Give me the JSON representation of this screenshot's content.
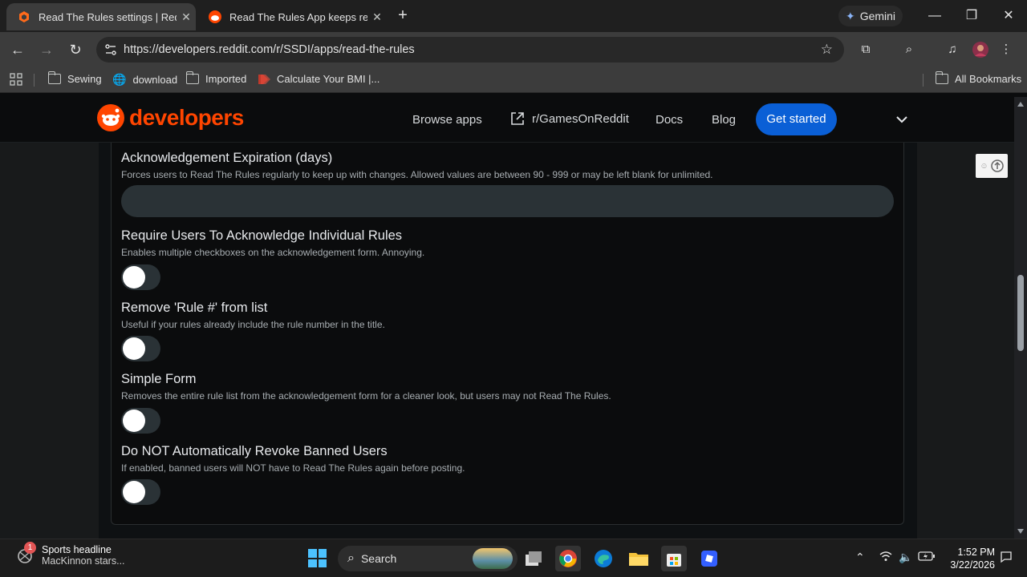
{
  "browser": {
    "tabs": [
      {
        "title": "Read The Rules settings | Reddit",
        "active": true
      },
      {
        "title": "Read The Rules App keeps remembering",
        "active": false
      }
    ],
    "gemini_label": "Gemini",
    "url": "https://developers.reddit.com/r/SSDI/apps/read-the-rules",
    "bookmarks": [
      "Sewing",
      "download",
      "Imported",
      "Calculate Your BMI |..."
    ],
    "all_bookmarks": "All Bookmarks"
  },
  "site": {
    "logo_text": "developers",
    "nav": [
      "Browse apps",
      "r/GamesOnReddit",
      "Docs",
      "Blog"
    ],
    "cta": "Get started"
  },
  "settings": {
    "expiration": {
      "label": "Acknowledgement Expiration (days)",
      "description": "Forces users to Read The Rules regularly to keep up with changes. Allowed values are between 90 - 999 or may be left blank for unlimited.",
      "value": ""
    },
    "toggles": [
      {
        "label": "Require Users To Acknowledge Individual Rules",
        "description": "Enables multiple checkboxes on the acknowledgement form. Annoying.",
        "enabled": false
      },
      {
        "label": "Remove 'Rule #' from list",
        "description": "Useful if your rules already include the rule number in the title.",
        "enabled": false
      },
      {
        "label": "Simple Form",
        "description": "Removes the entire rule list from the acknowledgement form for a cleaner look, but users may not Read The Rules.",
        "enabled": false
      },
      {
        "label": "Do NOT Automatically Revoke Banned Users",
        "description": "If enabled, banned users will NOT have to Read The Rules again before posting.",
        "enabled": false
      }
    ]
  },
  "taskbar": {
    "widget_badge": "1",
    "widget_title": "Sports headline",
    "widget_sub": "MacKinnon stars...",
    "search_label": "Search",
    "time": "1:52 PM",
    "date": "3/22/2026"
  },
  "colors": {
    "reddit_orange": "#ff4500",
    "cta_blue": "#0a5fd6",
    "input_bg": "#2a3236"
  }
}
